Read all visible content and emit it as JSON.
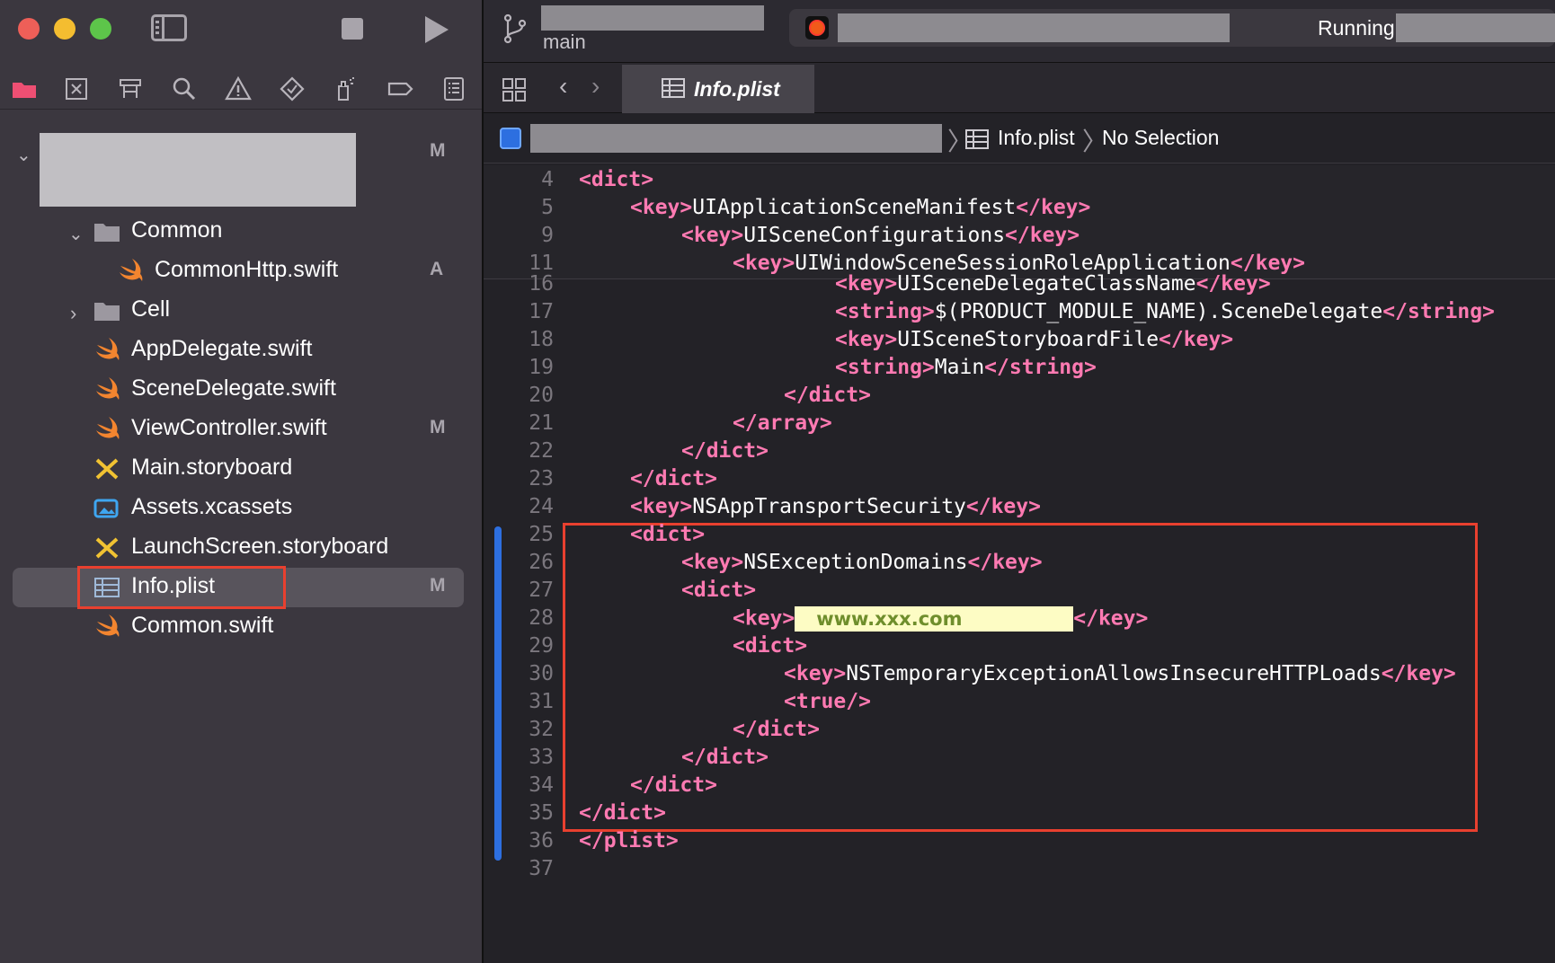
{
  "window": {
    "run_status": "Running",
    "branch": "main"
  },
  "navigator": {
    "items": [
      {
        "label": "",
        "badge": "M"
      },
      {
        "label": "Common",
        "badge": ""
      },
      {
        "label": "CommonHttp.swift",
        "badge": "A"
      },
      {
        "label": "Cell",
        "badge": ""
      },
      {
        "label": "AppDelegate.swift",
        "badge": ""
      },
      {
        "label": "SceneDelegate.swift",
        "badge": ""
      },
      {
        "label": "ViewController.swift",
        "badge": "M"
      },
      {
        "label": "Main.storyboard",
        "badge": ""
      },
      {
        "label": "Assets.xcassets",
        "badge": ""
      },
      {
        "label": "LaunchScreen.storyboard",
        "badge": ""
      },
      {
        "label": "Info.plist",
        "badge": "M"
      },
      {
        "label": "Common.swift",
        "badge": ""
      }
    ],
    "selected": "Info.plist"
  },
  "editor": {
    "tab": "Info.plist",
    "jump_bar": {
      "file": "Info.plist",
      "selection": "No Selection"
    },
    "lines": [
      {
        "n": "4",
        "parts": [
          [
            "t",
            "<dict>"
          ]
        ]
      },
      {
        "n": "5",
        "parts": [
          [
            "t",
            "<key>"
          ],
          [
            "x",
            "UIApplicationSceneManifest"
          ],
          [
            "t",
            "</key>"
          ]
        ]
      },
      {
        "n": "9",
        "parts": [
          [
            "t",
            "<key>"
          ],
          [
            "x",
            "UISceneConfigurations"
          ],
          [
            "t",
            "</key>"
          ]
        ]
      },
      {
        "n": "11",
        "parts": [
          [
            "t",
            "<key>"
          ],
          [
            "x",
            "UIWindowSceneSessionRoleApplication"
          ],
          [
            "t",
            "</key>"
          ]
        ]
      },
      {
        "n": "16",
        "parts": [
          [
            "t",
            "<key>"
          ],
          [
            "x",
            "UISceneDelegateClassName"
          ],
          [
            "t",
            "</key>"
          ]
        ]
      },
      {
        "n": "17",
        "parts": [
          [
            "t",
            "<string>"
          ],
          [
            "x",
            "$(PRODUCT_MODULE_NAME).SceneDelegate"
          ],
          [
            "t",
            "</string>"
          ]
        ]
      },
      {
        "n": "18",
        "parts": [
          [
            "t",
            "<key>"
          ],
          [
            "x",
            "UISceneStoryboardFile"
          ],
          [
            "t",
            "</key>"
          ]
        ]
      },
      {
        "n": "19",
        "parts": [
          [
            "t",
            "<string>"
          ],
          [
            "x",
            "Main"
          ],
          [
            "t",
            "</string>"
          ]
        ]
      },
      {
        "n": "20",
        "parts": [
          [
            "t",
            "</dict>"
          ]
        ]
      },
      {
        "n": "21",
        "parts": [
          [
            "t",
            "</array>"
          ]
        ]
      },
      {
        "n": "22",
        "parts": [
          [
            "t",
            "</dict>"
          ]
        ]
      },
      {
        "n": "23",
        "parts": [
          [
            "t",
            "</dict>"
          ]
        ]
      },
      {
        "n": "24",
        "parts": [
          [
            "t",
            "<key>"
          ],
          [
            "x",
            "NSAppTransportSecurity"
          ],
          [
            "t",
            "</key>"
          ]
        ]
      },
      {
        "n": "25",
        "parts": [
          [
            "t",
            "<dict>"
          ]
        ]
      },
      {
        "n": "26",
        "parts": [
          [
            "t",
            "<key>"
          ],
          [
            "x",
            "NSExceptionDomains"
          ],
          [
            "t",
            "</key>"
          ]
        ]
      },
      {
        "n": "27",
        "parts": [
          [
            "t",
            "<dict>"
          ]
        ]
      },
      {
        "n": "28",
        "parts": [
          [
            "t",
            "<key>"
          ],
          [
            "h",
            "www.xxx.com"
          ],
          [
            "t",
            "</key>"
          ]
        ]
      },
      {
        "n": "29",
        "parts": [
          [
            "t",
            "<dict>"
          ]
        ]
      },
      {
        "n": "30",
        "parts": [
          [
            "t",
            "<key>"
          ],
          [
            "x",
            "NSTemporaryExceptionAllowsInsecureHTTPLoads"
          ],
          [
            "t",
            "</key>"
          ]
        ]
      },
      {
        "n": "31",
        "parts": [
          [
            "t",
            "<true/>"
          ]
        ]
      },
      {
        "n": "32",
        "parts": [
          [
            "t",
            "</dict>"
          ]
        ]
      },
      {
        "n": "33",
        "parts": [
          [
            "t",
            "</dict>"
          ]
        ]
      },
      {
        "n": "34",
        "parts": [
          [
            "t",
            "</dict>"
          ]
        ]
      },
      {
        "n": "35",
        "parts": [
          [
            "t",
            "</dict>"
          ]
        ]
      },
      {
        "n": "36",
        "parts": [
          [
            "t",
            "</plist>"
          ]
        ]
      },
      {
        "n": "37",
        "parts": []
      }
    ]
  },
  "colors": {
    "tag": "#ff7ab2",
    "text": "#ffffff",
    "highlight_box": "#e8402f",
    "change_bar": "#2d6fe0"
  }
}
